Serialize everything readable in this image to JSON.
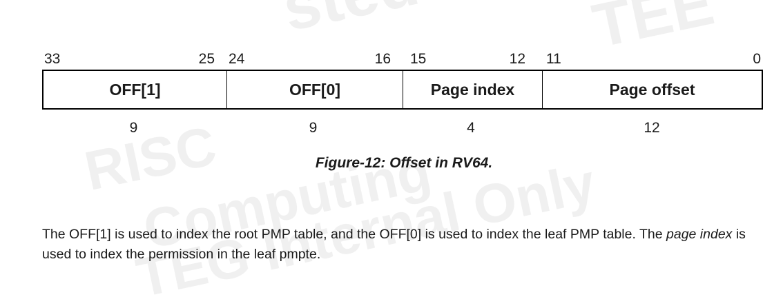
{
  "watermark": {
    "line1": "sted",
    "line2": "TEE",
    "line3": "RISC",
    "line4": "Computing",
    "line5": "TEG Internal Only"
  },
  "bit_numbers": [
    "33",
    "25",
    "24",
    "16",
    "15",
    "12",
    "11",
    "0"
  ],
  "fields": [
    {
      "label": "OFF[1]",
      "width": "9"
    },
    {
      "label": "OFF[0]",
      "width": "9"
    },
    {
      "label": "Page index",
      "width": "4"
    },
    {
      "label": "Page offset",
      "width": "12"
    }
  ],
  "caption": "Figure-12: Offset in RV64.",
  "paragraph": {
    "part1": "The OFF[1] is used to index the root PMP table, and the OFF[0] is used to index the leaf PMP table. The ",
    "emphasis": "page index",
    "part2": " is used to index the permission in the leaf pmpte."
  }
}
